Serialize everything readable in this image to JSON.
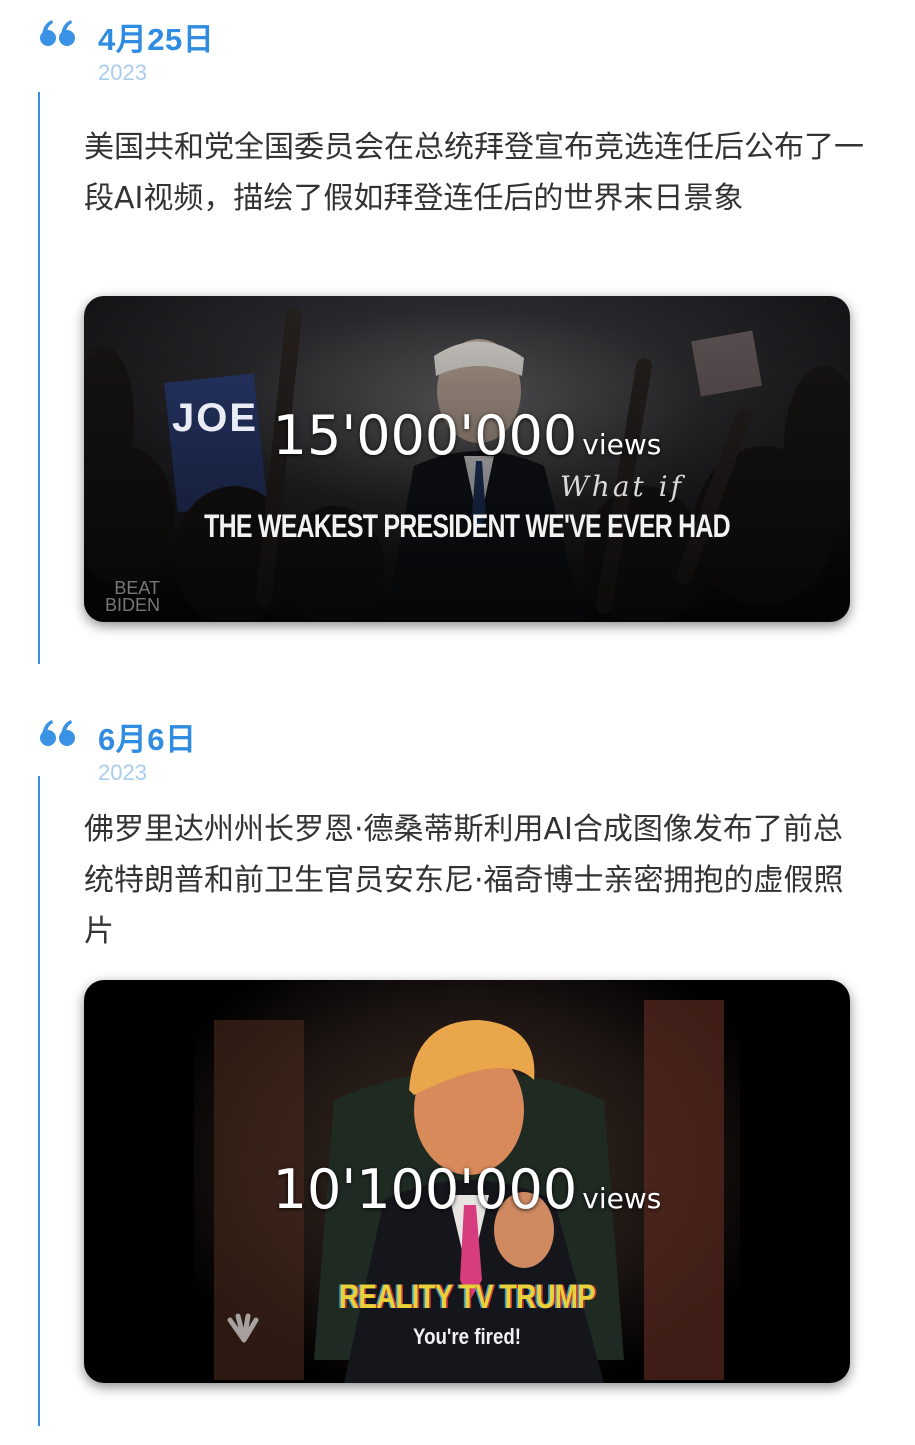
{
  "colors": {
    "accent": "#2f8ce0",
    "year": "#a9cdee",
    "timeline_line": "#3a92e4"
  },
  "entries": [
    {
      "icon": "quote-icon",
      "date": "4月25日",
      "year": "2023",
      "description": "美国共和党全国委员会在总统拜登宣布竞选连任后公布了一段AI视频，描绘了假如拜登连任后的世界末日景象",
      "media": {
        "views_number": "15'000'000",
        "views_word": "views",
        "caption_script": "What if",
        "caption_bold": "THE WEAKEST PRESIDENT WE'VE EVER HAD",
        "sign_text": "JOE",
        "logo_line1": "BEAT",
        "logo_line2": "BIDEN"
      }
    },
    {
      "icon": "quote-icon",
      "date": "6月6日",
      "year": "2023",
      "description": "佛罗里达州州长罗恩·德桑蒂斯利用AI合成图像发布了前总统特朗普和前卫生官员安东尼·福奇博士亲密拥抱的虚假照片",
      "media": {
        "views_number": "10'100'000",
        "views_word": "views",
        "title": "REALITY TV TRUMP",
        "subtitle": "You're fired!"
      }
    }
  ]
}
